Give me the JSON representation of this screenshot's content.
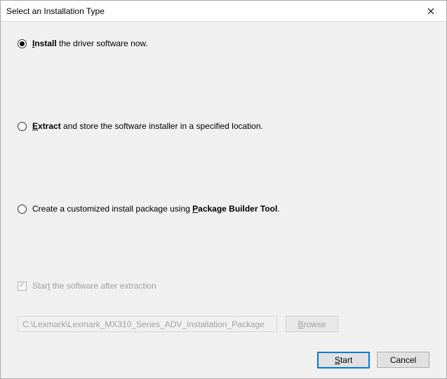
{
  "window": {
    "title": "Select an Installation Type"
  },
  "options": {
    "install": {
      "boldPrefix": "I",
      "boldRest": "nstall",
      "rest": " the driver software now.",
      "selected": true
    },
    "extract": {
      "boldPrefix": "E",
      "boldRest": "xtract",
      "rest": " and store the software installer in a specified location.",
      "selected": false
    },
    "custom": {
      "before": "Create a customized install package using ",
      "boldPrefix": "P",
      "boldRest": "ackage Builder Tool",
      "after": ".",
      "selected": false
    }
  },
  "checkbox": {
    "label_before": "Star",
    "label_underline": "t",
    "label_after": " the software after extraction",
    "checked": true,
    "disabled": true
  },
  "path": {
    "value": "C:\\Lexmark\\Lexmark_MX310_Series_ADV_Installation_Package",
    "disabled": true
  },
  "buttons": {
    "browse_prefix": "B",
    "browse_rest": "rowse",
    "start_prefix": "S",
    "start_rest": "tart",
    "cancel": "Cancel"
  }
}
